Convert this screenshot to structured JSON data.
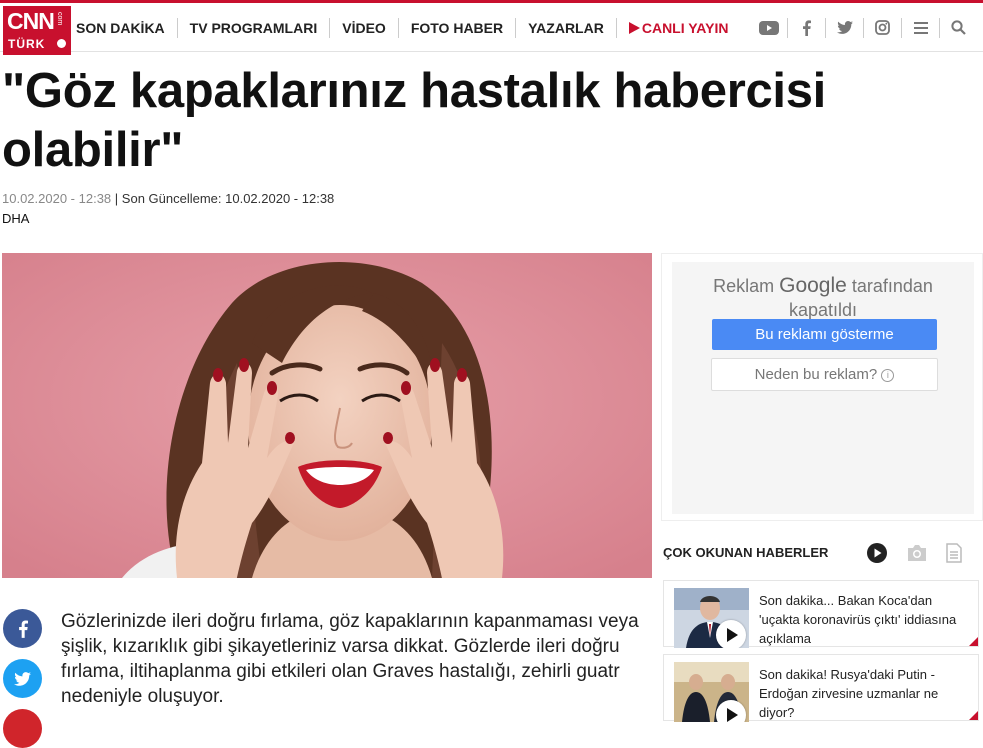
{
  "logo": {
    "main": "CNN",
    "suffix": "com",
    "sub": "TÜRK"
  },
  "nav": {
    "items": [
      "SON DAKİKA",
      "TV PROGRAMLARI",
      "VİDEO",
      "FOTO HABER",
      "YAZARLAR"
    ],
    "live": "CANLI YAYIN"
  },
  "social_icons": [
    "youtube-icon",
    "facebook-icon",
    "twitter-icon",
    "instagram-icon",
    "menu-icon",
    "search-icon"
  ],
  "article": {
    "title": "\"Göz kapaklarınız hastalık habercisi olabilir\"",
    "date": "10.02.2020 - 12:38",
    "separator": "|",
    "updated": "Son Güncelleme: 10.02.2020 - 12:38",
    "source": "DHA",
    "lead": "Gözlerinizde ileri doğru fırlama, göz kapaklarının kapanmaması veya şişlik, kızarıklık gibi şikayetleriniz varsa dikkat. Gözlerde ileri doğru fırlama, iltihaplanma gibi etkileri olan Graves hastalığı, zehirli guatr nedeniyle oluşuyor."
  },
  "ad": {
    "text_before": "Reklam",
    "brand": "Google",
    "text_after": "tarafından",
    "line2": "kapatıldı",
    "stop_button": "Bu reklamı gösterme",
    "why_button": "Neden bu reklam?"
  },
  "popular": {
    "heading": "ÇOK OKUNAN HABERLER",
    "items": [
      {
        "title": "Son dakika... Bakan Koca'dan 'uçakta koronavirüs çıktı' iddiasına açıklama"
      },
      {
        "title": "Son dakika! Rusya'daki Putin - Erdoğan zirvesine uzmanlar ne diyor?"
      }
    ]
  },
  "colors": {
    "brand_red": "#c8102e",
    "facebook": "#3b5998",
    "twitter": "#1da1f2",
    "ad_blue": "#4a8af4"
  }
}
